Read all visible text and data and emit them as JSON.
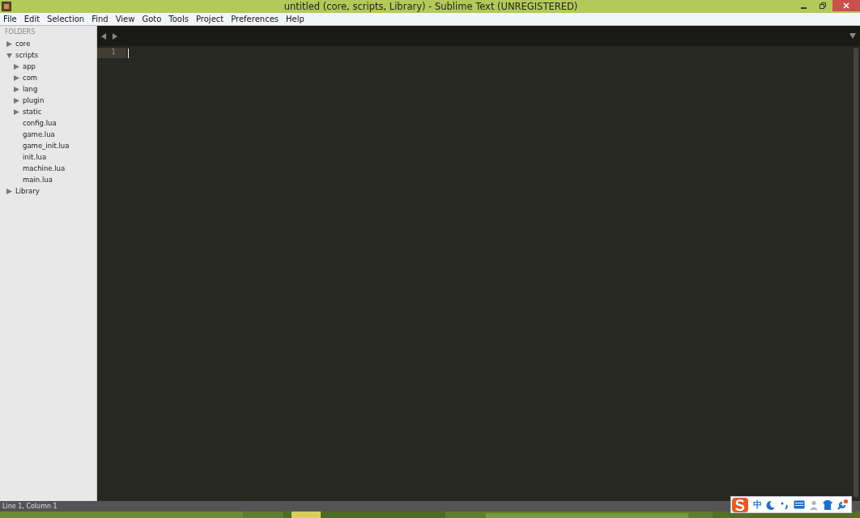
{
  "window": {
    "title": "untitled (core, scripts, Library) - Sublime Text (UNREGISTERED)"
  },
  "menu": [
    "File",
    "Edit",
    "Selection",
    "Find",
    "View",
    "Goto",
    "Tools",
    "Project",
    "Preferences",
    "Help"
  ],
  "sidebar": {
    "heading": "FOLDERS",
    "items": [
      {
        "label": "core",
        "kind": "folder",
        "expanded": false
      },
      {
        "label": "scripts",
        "kind": "folder",
        "expanded": true,
        "children": [
          {
            "label": "app",
            "kind": "folder",
            "expanded": false
          },
          {
            "label": "com",
            "kind": "folder",
            "expanded": false
          },
          {
            "label": "lang",
            "kind": "folder",
            "expanded": false
          },
          {
            "label": "plugin",
            "kind": "folder",
            "expanded": false
          },
          {
            "label": "static",
            "kind": "folder",
            "expanded": false
          },
          {
            "label": "config.lua",
            "kind": "file"
          },
          {
            "label": "game.lua",
            "kind": "file"
          },
          {
            "label": "game_init.lua",
            "kind": "file"
          },
          {
            "label": "init.lua",
            "kind": "file"
          },
          {
            "label": "machine.lua",
            "kind": "file"
          },
          {
            "label": "main.lua",
            "kind": "file"
          }
        ]
      },
      {
        "label": "Library",
        "kind": "folder",
        "expanded": false
      }
    ]
  },
  "editor": {
    "line_numbers": [
      "1"
    ]
  },
  "status_bar": {
    "position": "Line 1, Column 1"
  },
  "ime_toolbar": {
    "mode": "中"
  }
}
